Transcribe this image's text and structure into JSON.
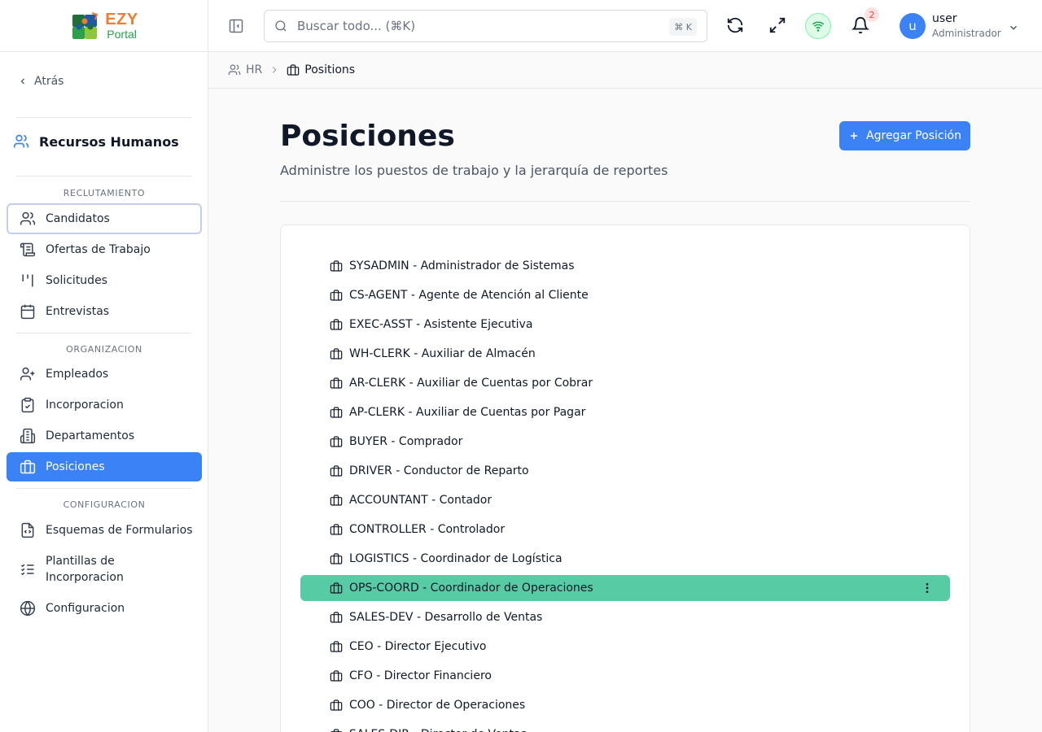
{
  "brand": {
    "name_a": "EZY",
    "name_b": "Portal"
  },
  "sidebar": {
    "back_label": "Atrás",
    "module_title": "Recursos Humanos",
    "groups": [
      {
        "label": "RECLUTAMIENTO",
        "items": [
          {
            "label": "Candidatos",
            "icon": "users-icon"
          },
          {
            "label": "Ofertas de Trabajo",
            "icon": "scroll-icon"
          },
          {
            "label": "Solicitudes",
            "icon": "kanban-icon"
          },
          {
            "label": "Entrevistas",
            "icon": "calendar-icon"
          }
        ]
      },
      {
        "label": "ORGANIZACION",
        "items": [
          {
            "label": "Empleados",
            "icon": "user-plus-icon"
          },
          {
            "label": "Incorporacion",
            "icon": "clipboard-check-icon"
          },
          {
            "label": "Departamentos",
            "icon": "building-icon"
          },
          {
            "label": "Posiciones",
            "icon": "briefcase-icon",
            "active": true
          }
        ]
      },
      {
        "label": "CONFIGURACION",
        "items": [
          {
            "label": "Esquemas de Formularios",
            "icon": "file-code-icon"
          },
          {
            "label": "Plantillas de Incorporacion",
            "icon": "list-checks-icon"
          },
          {
            "label": "Configuracion",
            "icon": "globe-icon"
          }
        ]
      }
    ]
  },
  "header": {
    "search_placeholder": "Buscar todo... (⌘K)",
    "search_shortcut": "⌘ K",
    "notification_count": "2",
    "user": {
      "initial": "u",
      "name": "user",
      "role": "Administrador"
    }
  },
  "breadcrumb": [
    {
      "label": "HR"
    },
    {
      "label": "Positions"
    }
  ],
  "page": {
    "title": "Posiciones",
    "subtitle": "Administre los puestos de trabajo y la jerarquía de reportes",
    "add_button_label": "Agregar Posición"
  },
  "positions": [
    "SYSADMIN - Administrador de Sistemas",
    "CS-AGENT - Agente de Atención al Cliente",
    "EXEC-ASST - Asistente Ejecutiva",
    "WH-CLERK - Auxiliar de Almacén",
    "AR-CLERK - Auxiliar de Cuentas por Cobrar",
    "AP-CLERK - Auxiliar de Cuentas por Pagar",
    "BUYER - Comprador",
    "DRIVER - Conductor de Reparto",
    "ACCOUNTANT - Contador",
    "CONTROLLER - Controlador",
    "LOGISTICS - Coordinador de Logística",
    "OPS-COORD - Coordinador de Operaciones",
    "SALES-DEV - Desarrollo de Ventas",
    "CEO - Director Ejecutivo",
    "CFO - Director Financiero",
    "COO - Director de Operaciones",
    "SALES-DIR - Director de Ventas"
  ],
  "selected_position": "OPS-COORD - Coordinador de Operaciones",
  "colors": {
    "accent": "#3b82f6",
    "selected_row": "#57cba4",
    "brand_orange": "#f07c2c",
    "brand_green": "#22a54a"
  }
}
